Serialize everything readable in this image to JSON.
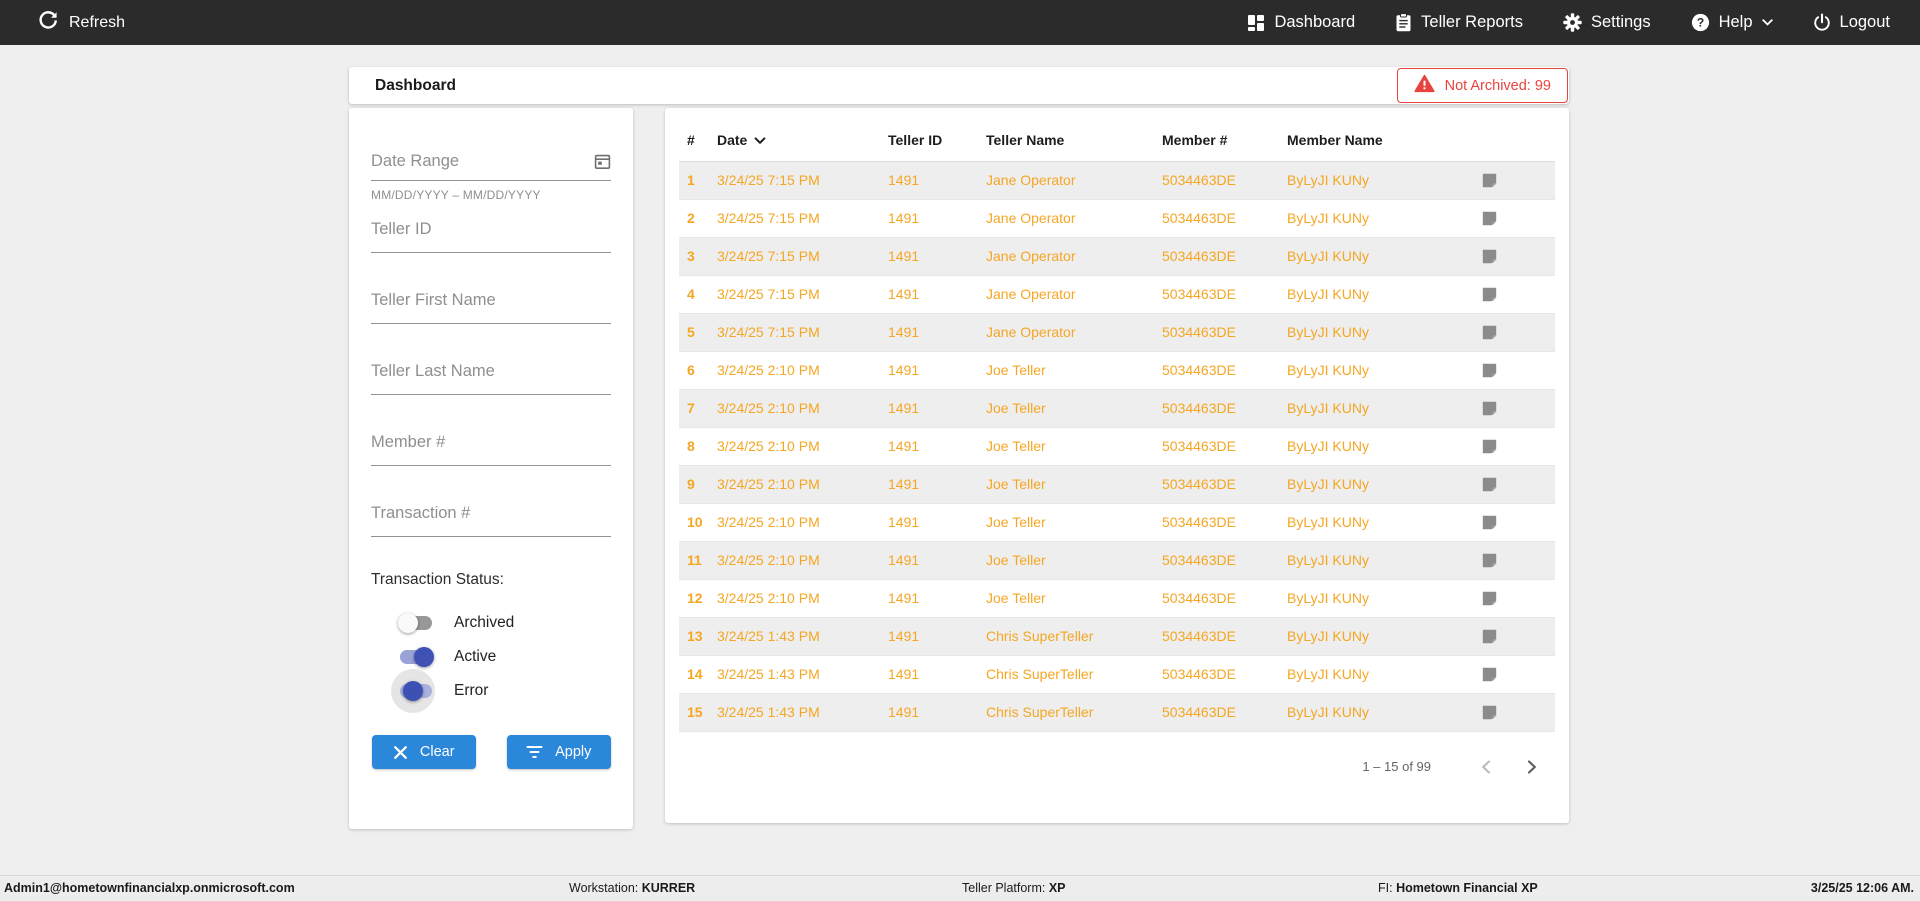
{
  "topbar": {
    "refresh_label": "Refresh",
    "nav": [
      {
        "label": "Dashboard"
      },
      {
        "label": "Teller Reports"
      },
      {
        "label": "Settings"
      },
      {
        "label": "Help"
      },
      {
        "label": "Logout"
      }
    ]
  },
  "header": {
    "title": "Dashboard",
    "alert_text": "Not Archived: 99"
  },
  "filters": {
    "date_range": {
      "placeholder": "Date Range",
      "hint": "MM/DD/YYYY – MM/DD/YYYY"
    },
    "teller_id_placeholder": "Teller ID",
    "teller_first_name_placeholder": "Teller First Name",
    "teller_last_name_placeholder": "Teller Last Name",
    "member_num_placeholder": "Member #",
    "transaction_num_placeholder": "Transaction #",
    "status": {
      "label": "Transaction Status:",
      "toggles": [
        {
          "label": "Archived",
          "state": "off"
        },
        {
          "label": "Active",
          "state": "on"
        },
        {
          "label": "Error",
          "state": "on-focused"
        }
      ]
    },
    "clear_label": "Clear",
    "apply_label": "Apply"
  },
  "table": {
    "columns": [
      "#",
      "Date",
      "Teller ID",
      "Teller Name",
      "Member #",
      "Member Name"
    ],
    "sorted_column": "Date",
    "sort_direction": "desc",
    "rows": [
      {
        "num": "1",
        "date": "3/24/25 7:15 PM",
        "teller_id": "1491",
        "teller_name": "Jane Operator",
        "member_num": "5034463DE",
        "member_name": "ByLyJI KUNy"
      },
      {
        "num": "2",
        "date": "3/24/25 7:15 PM",
        "teller_id": "1491",
        "teller_name": "Jane Operator",
        "member_num": "5034463DE",
        "member_name": "ByLyJI KUNy"
      },
      {
        "num": "3",
        "date": "3/24/25 7:15 PM",
        "teller_id": "1491",
        "teller_name": "Jane Operator",
        "member_num": "5034463DE",
        "member_name": "ByLyJI KUNy"
      },
      {
        "num": "4",
        "date": "3/24/25 7:15 PM",
        "teller_id": "1491",
        "teller_name": "Jane Operator",
        "member_num": "5034463DE",
        "member_name": "ByLyJI KUNy"
      },
      {
        "num": "5",
        "date": "3/24/25 7:15 PM",
        "teller_id": "1491",
        "teller_name": "Jane Operator",
        "member_num": "5034463DE",
        "member_name": "ByLyJI KUNy"
      },
      {
        "num": "6",
        "date": "3/24/25 2:10 PM",
        "teller_id": "1491",
        "teller_name": "Joe Teller",
        "member_num": "5034463DE",
        "member_name": "ByLyJI KUNy"
      },
      {
        "num": "7",
        "date": "3/24/25 2:10 PM",
        "teller_id": "1491",
        "teller_name": "Joe Teller",
        "member_num": "5034463DE",
        "member_name": "ByLyJI KUNy"
      },
      {
        "num": "8",
        "date": "3/24/25 2:10 PM",
        "teller_id": "1491",
        "teller_name": "Joe Teller",
        "member_num": "5034463DE",
        "member_name": "ByLyJI KUNy"
      },
      {
        "num": "9",
        "date": "3/24/25 2:10 PM",
        "teller_id": "1491",
        "teller_name": "Joe Teller",
        "member_num": "5034463DE",
        "member_name": "ByLyJI KUNy"
      },
      {
        "num": "10",
        "date": "3/24/25 2:10 PM",
        "teller_id": "1491",
        "teller_name": "Joe Teller",
        "member_num": "5034463DE",
        "member_name": "ByLyJI KUNy"
      },
      {
        "num": "11",
        "date": "3/24/25 2:10 PM",
        "teller_id": "1491",
        "teller_name": "Joe Teller",
        "member_num": "5034463DE",
        "member_name": "ByLyJI KUNy"
      },
      {
        "num": "12",
        "date": "3/24/25 2:10 PM",
        "teller_id": "1491",
        "teller_name": "Joe Teller",
        "member_num": "5034463DE",
        "member_name": "ByLyJI KUNy"
      },
      {
        "num": "13",
        "date": "3/24/25 1:43 PM",
        "teller_id": "1491",
        "teller_name": "Chris SuperTeller",
        "member_num": "5034463DE",
        "member_name": "ByLyJI KUNy"
      },
      {
        "num": "14",
        "date": "3/24/25 1:43 PM",
        "teller_id": "1491",
        "teller_name": "Chris SuperTeller",
        "member_num": "5034463DE",
        "member_name": "ByLyJI KUNy"
      },
      {
        "num": "15",
        "date": "3/24/25 1:43 PM",
        "teller_id": "1491",
        "teller_name": "Chris SuperTeller",
        "member_num": "5034463DE",
        "member_name": "ByLyJI KUNy"
      }
    ],
    "pagination": "1 – 15 of 99"
  },
  "footer": {
    "user": "Admin1@hometownfinancialxp.onmicrosoft.com",
    "workstation_label": "Workstation: ",
    "workstation": "KURRER",
    "platform_label": "Teller Platform: ",
    "platform": "XP",
    "fi_label": "FI: ",
    "fi": "Hometown Financial XP",
    "datetime": "3/25/25 12:06 AM."
  },
  "colors": {
    "topbar_bg": "#2b2b2b",
    "accent_blue": "#2b87d9",
    "row_orange": "#f5a623",
    "alert_red": "#e8443f",
    "toggle_indigo": "#3f51b5",
    "page_bg": "#efefef"
  }
}
